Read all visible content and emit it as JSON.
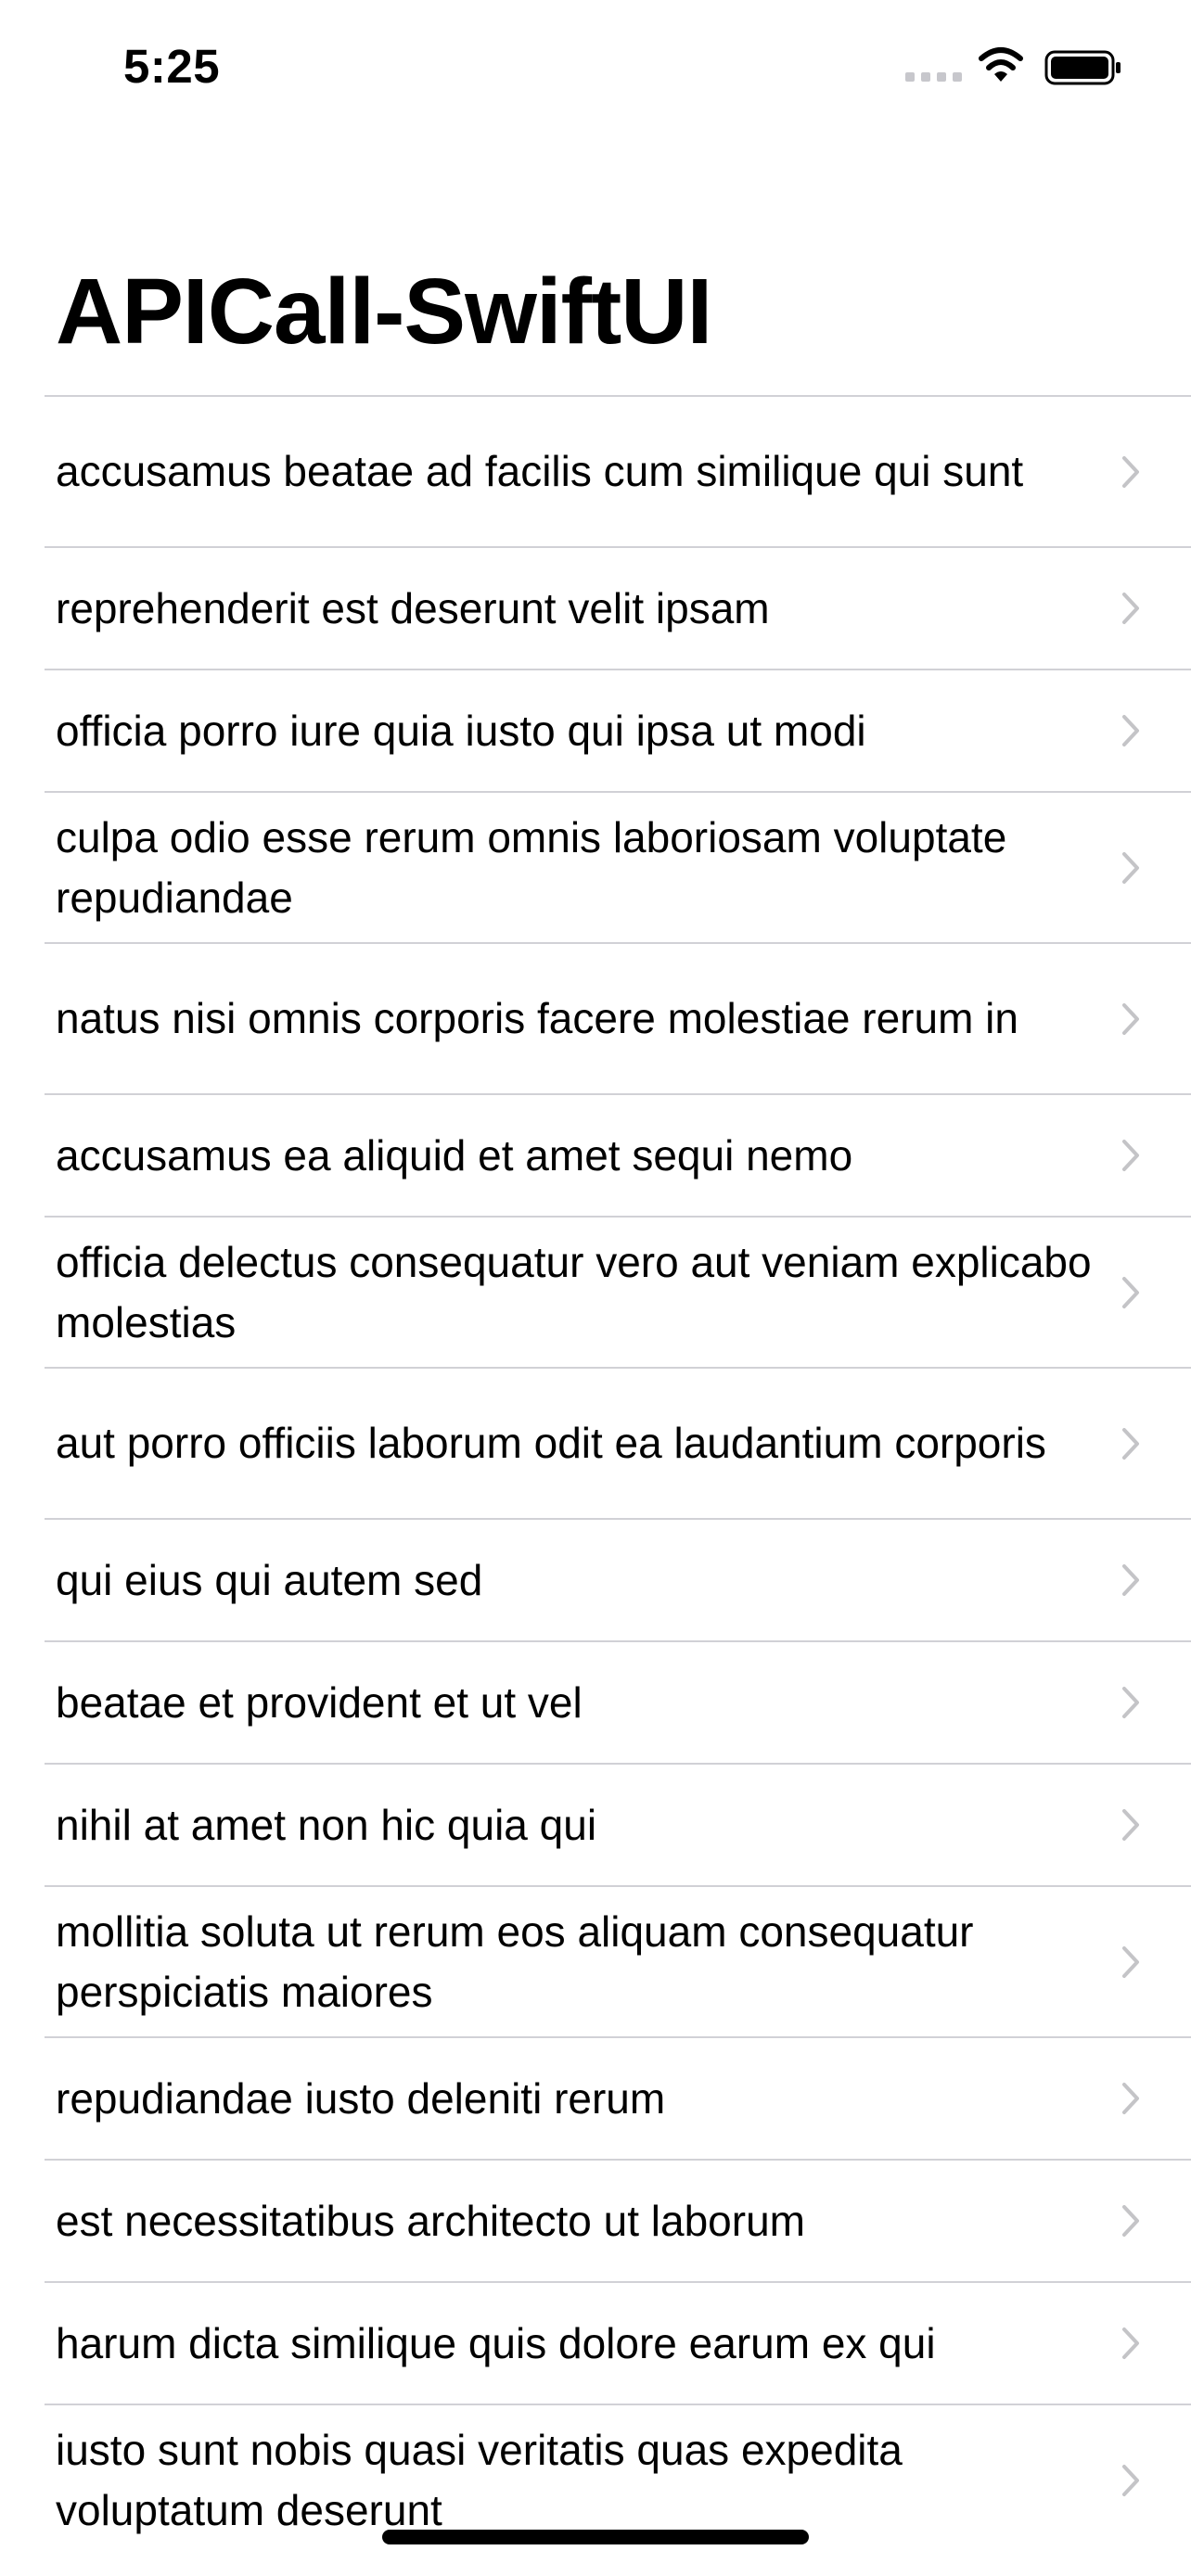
{
  "status_bar": {
    "time": "5:25",
    "icons": [
      "cellular-signal-icon",
      "wifi-icon",
      "battery-icon"
    ]
  },
  "navigation": {
    "title": "APICall-SwiftUI"
  },
  "list": {
    "items": [
      "accusamus beatae ad facilis cum similique qui sunt",
      "reprehenderit est deserunt velit ipsam",
      "officia porro iure quia iusto qui ipsa ut modi",
      "culpa odio esse rerum omnis laboriosam voluptate repudiandae",
      "natus nisi omnis corporis facere molestiae rerum in",
      "accusamus ea aliquid et amet sequi nemo",
      "officia delectus consequatur vero aut veniam explicabo molestias",
      "aut porro officiis laborum odit ea laudantium corporis",
      "qui eius qui autem sed",
      "beatae et provident et ut vel",
      "nihil at amet non hic quia qui",
      "mollitia soluta ut rerum eos aliquam consequatur perspiciatis maiores",
      "repudiandae iusto deleniti rerum",
      "est necessitatibus architecto ut laborum",
      "harum dicta similique quis dolore earum ex qui",
      "iusto sunt nobis quasi veritatis quas expedita voluptatum deserunt"
    ],
    "row_icon": "chevron-right-icon"
  },
  "colors": {
    "background": "#ffffff",
    "text": "#000000",
    "separator": "#d1d1d6",
    "chevron": "#c4c4c7",
    "signal_inactive": "#c7c7cc"
  }
}
